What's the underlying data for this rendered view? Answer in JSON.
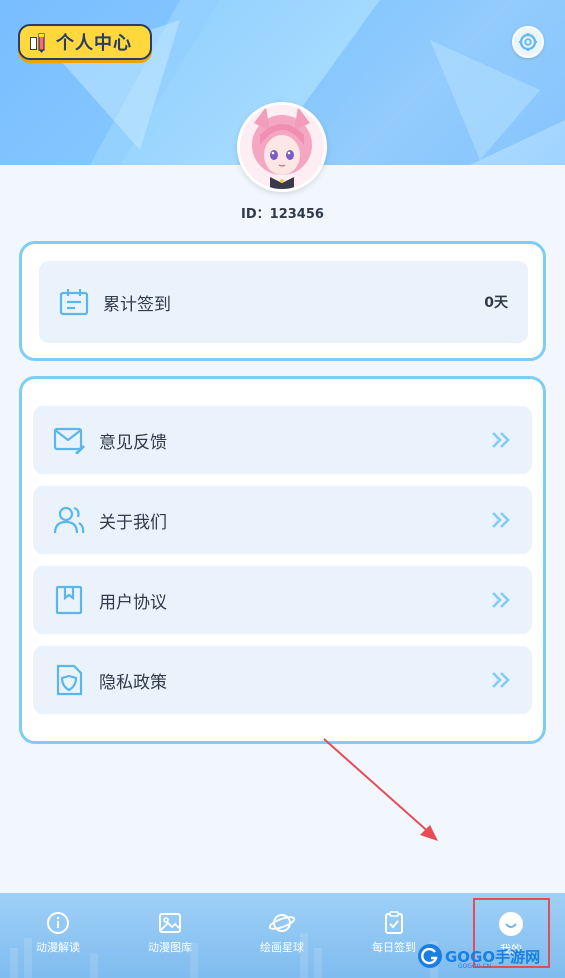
{
  "header": {
    "title": "个人中心"
  },
  "profile": {
    "id_text": "ID：123456"
  },
  "checkin": {
    "label": "累计签到",
    "value": "0天"
  },
  "menu": {
    "items": [
      {
        "label": "意见反馈",
        "icon": "mail-icon"
      },
      {
        "label": "关于我们",
        "icon": "users-icon"
      },
      {
        "label": "用户协议",
        "icon": "bookmark-icon"
      },
      {
        "label": "隐私政策",
        "icon": "shield-icon"
      }
    ]
  },
  "tabbar": {
    "tabs": [
      {
        "label": "动漫解读",
        "icon": "info-icon"
      },
      {
        "label": "动漫图库",
        "icon": "image-icon"
      },
      {
        "label": "绘画星球",
        "icon": "planet-icon"
      },
      {
        "label": "每日签到",
        "icon": "clipboard-check-icon"
      },
      {
        "label": "我的",
        "icon": "smile-icon",
        "active": true
      }
    ]
  },
  "watermark": {
    "brand": "GOGO手游网",
    "sub": "GOGO0.CN"
  },
  "colors": {
    "accent": "#7fcdf4",
    "badge": "#ffd93b",
    "highlight": "#e74c55"
  }
}
